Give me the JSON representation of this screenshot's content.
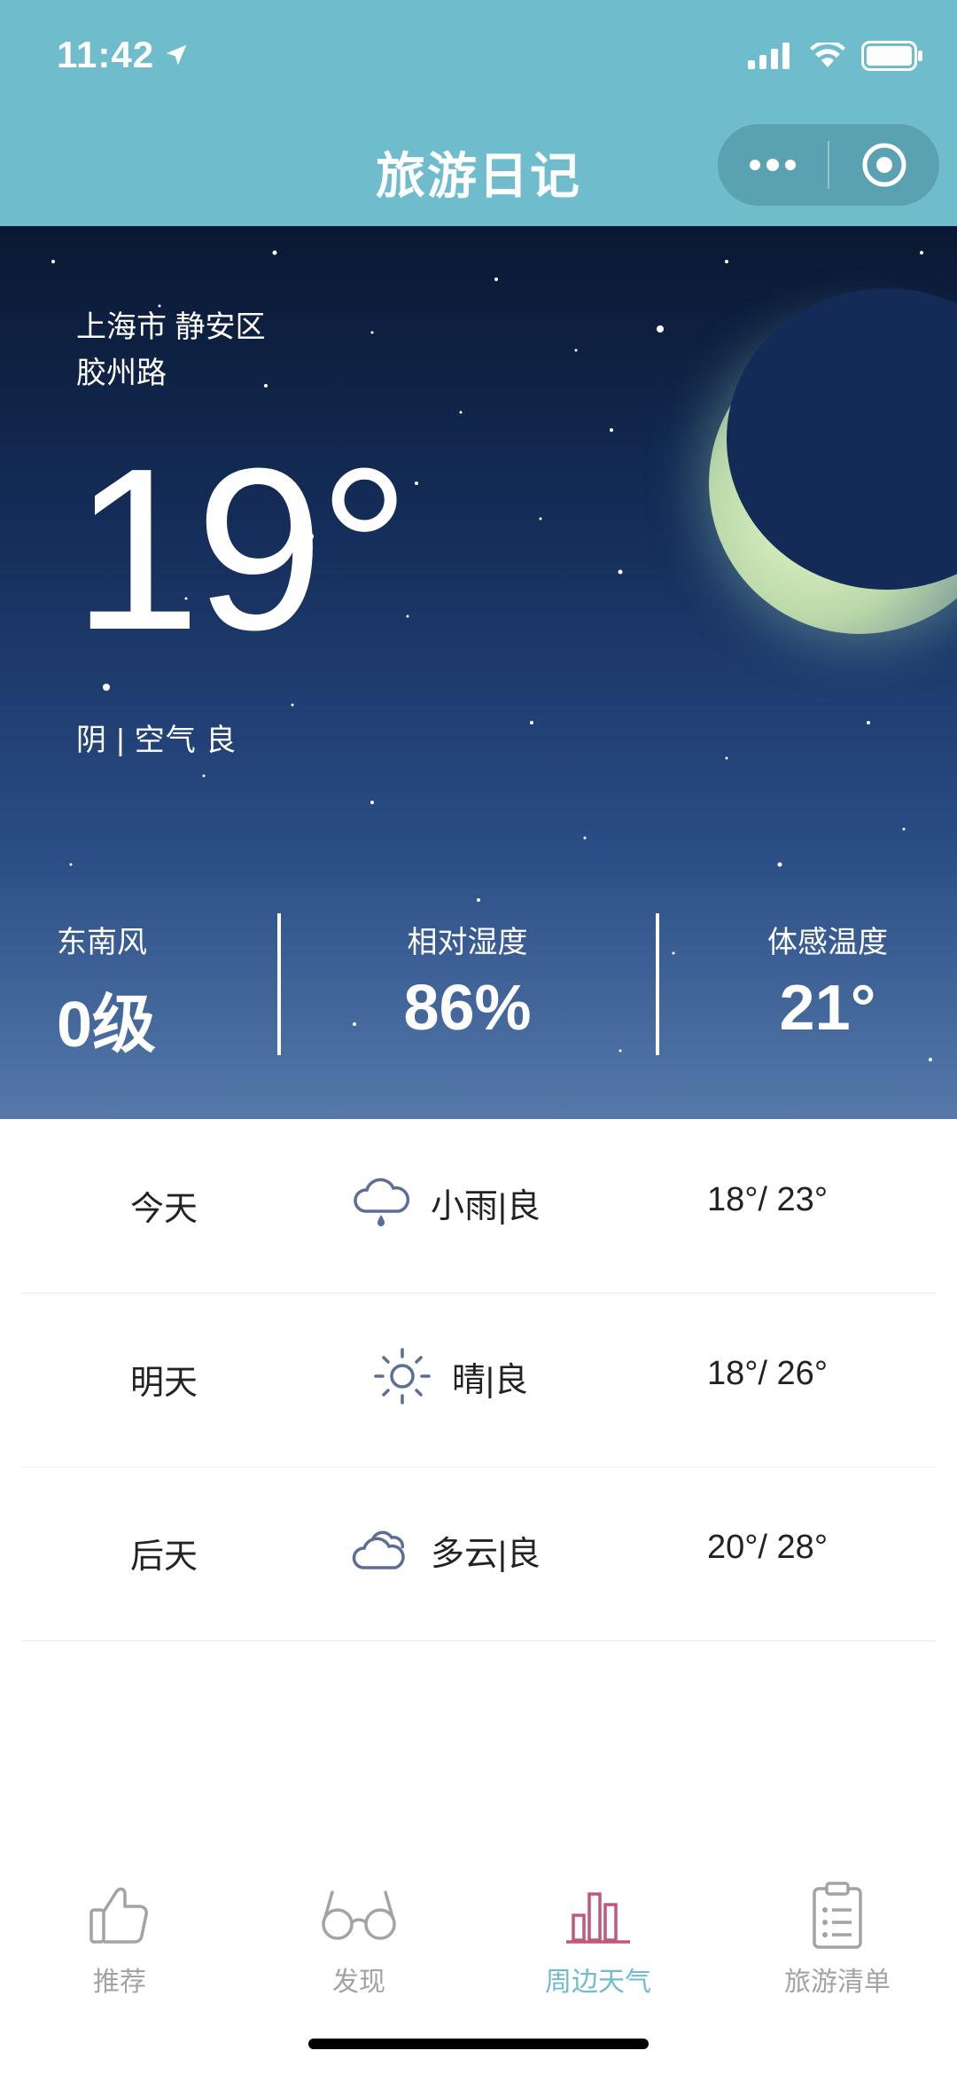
{
  "status_bar": {
    "time": "11:42"
  },
  "nav": {
    "title": "旅游日记"
  },
  "weather": {
    "location_line1": "上海市 静安区",
    "location_line2": "胶州路",
    "temperature": "19°",
    "description": "阴 | 空气 良",
    "stats": [
      {
        "label": "东南风",
        "value": "0级"
      },
      {
        "label": "相对湿度",
        "value": "86%"
      },
      {
        "label": "体感温度",
        "value": "21°"
      }
    ]
  },
  "forecast": [
    {
      "day": "今天",
      "icon": "rain-cloud-icon",
      "condition": "小雨|良",
      "range": "18°/ 23°"
    },
    {
      "day": "明天",
      "icon": "sun-icon",
      "condition": "晴|良",
      "range": "18°/ 26°"
    },
    {
      "day": "后天",
      "icon": "cloudy-icon",
      "condition": "多云|良",
      "range": "20°/ 28°"
    }
  ],
  "tabs": [
    {
      "label": "推荐",
      "icon": "thumbs-up-icon",
      "active": false
    },
    {
      "label": "发现",
      "icon": "glasses-icon",
      "active": false
    },
    {
      "label": "周边天气",
      "icon": "bar-chart-icon",
      "active": true
    },
    {
      "label": "旅游清单",
      "icon": "clipboard-list-icon",
      "active": false
    }
  ],
  "colors": {
    "theme": "#6fbccd",
    "tab_active": "#6fbccd",
    "tab_inactive": "#a3a3a3",
    "weather_icon": "#5b6f95",
    "bar_icon": "#c2577a"
  }
}
